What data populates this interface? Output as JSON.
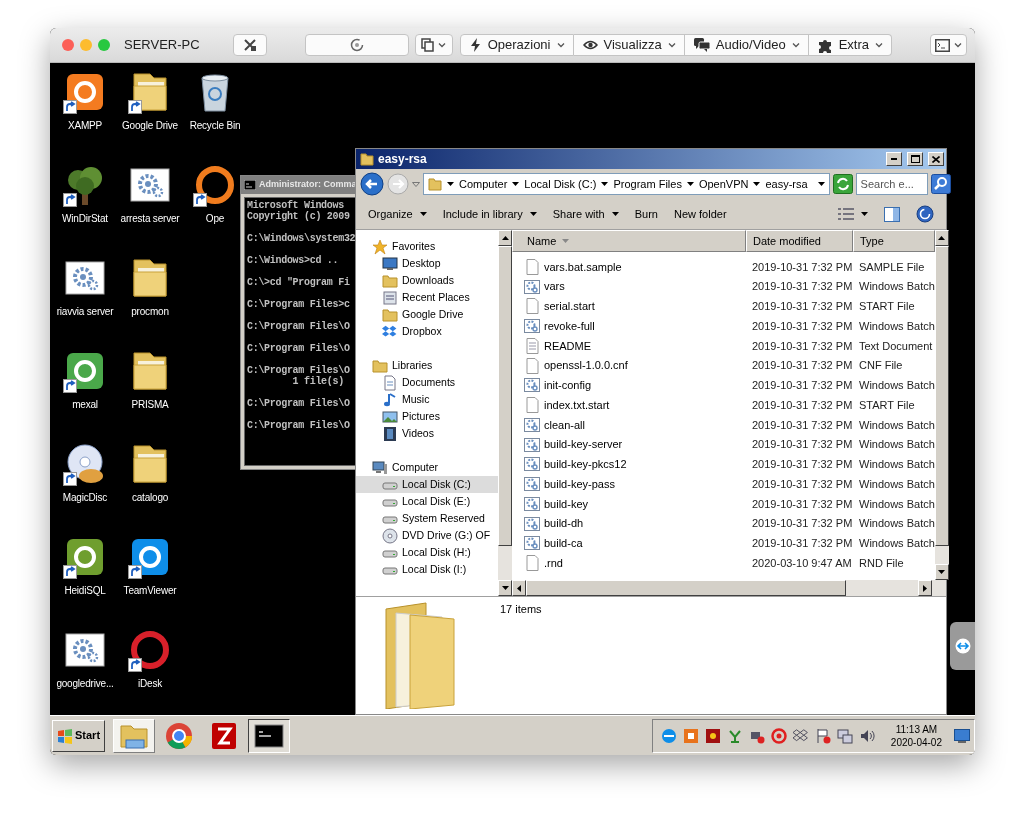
{
  "remote_window": {
    "title": "SERVER-PC",
    "menus": [
      {
        "kind": "bolt",
        "label": "Operazioni"
      },
      {
        "kind": "eye",
        "label": "Visualizza"
      },
      {
        "kind": "chat",
        "label": "Audio/Video"
      },
      {
        "kind": "puzzle",
        "label": "Extra"
      }
    ]
  },
  "desktop": {
    "icon_columns": [
      [
        {
          "label": "XAMPP",
          "kind": "app",
          "color": "#f47b20",
          "shortcut": true
        },
        {
          "label": "WinDirStat",
          "kind": "tree",
          "shortcut": true
        },
        {
          "label": "riavvia server",
          "kind": "script",
          "shortcut": false
        },
        {
          "label": "mexal",
          "kind": "app",
          "color": "#4aa84a",
          "shortcut": true
        },
        {
          "label": "MagicDisc",
          "kind": "disc",
          "shortcut": true
        },
        {
          "label": "HeidiSQL",
          "kind": "app",
          "color": "#6f9e2e",
          "shortcut": true
        },
        {
          "label": "googledrive...",
          "kind": "script",
          "shortcut": false
        }
      ],
      [
        {
          "label": "Google Drive",
          "kind": "folder",
          "shortcut": true
        },
        {
          "label": "arresta server",
          "kind": "script",
          "shortcut": false
        },
        {
          "label": "procmon",
          "kind": "folder",
          "shortcut": false
        },
        {
          "label": "PRISMA",
          "kind": "folder",
          "shortcut": false
        },
        {
          "label": "catalogo",
          "kind": "folder",
          "shortcut": false
        },
        {
          "label": "TeamViewer",
          "kind": "app",
          "color": "#0e8ee9",
          "shortcut": true
        },
        {
          "label": "iDesk",
          "kind": "ring",
          "color": "#d8202a",
          "shortcut": true
        }
      ],
      [
        {
          "label": "Recycle Bin",
          "kind": "bin",
          "shortcut": false
        },
        {
          "label": "Ope",
          "kind": "ring",
          "color": "#f07c1e",
          "shortcut": true
        }
      ]
    ]
  },
  "console": {
    "title": "Administrator: Comma",
    "paragraphs": [
      [
        "Microsoft Windows",
        "Copyright (c) 2009"
      ],
      [
        "C:\\Windows\\system32"
      ],
      [
        "C:\\Windows>cd .."
      ],
      [
        "C:\\>cd \"Program Fi"
      ],
      [
        "C:\\Program Files>c"
      ],
      [
        "C:\\Program Files\\O"
      ],
      [
        "C:\\Program Files\\O"
      ],
      [
        "C:\\Program Files\\O",
        "        1 file(s)"
      ],
      [
        "C:\\Program Files\\O"
      ],
      [
        "C:\\Program Files\\O"
      ]
    ]
  },
  "explorer": {
    "title": "easy-rsa",
    "breadcrumbs": [
      "Computer",
      "Local Disk (C:)",
      "Program Files",
      "OpenVPN",
      "easy-rsa"
    ],
    "search_placeholder": "Search e...",
    "commands": [
      {
        "label": "Organize",
        "dropdown": true
      },
      {
        "label": "Include in library",
        "dropdown": true
      },
      {
        "label": "Share with",
        "dropdown": true
      },
      {
        "label": "Burn",
        "dropdown": false
      },
      {
        "label": "New folder",
        "dropdown": false
      }
    ],
    "nav": [
      {
        "label": "Favorites",
        "kind": "star",
        "selected": false,
        "children": [
          {
            "label": "Desktop",
            "kind": "monitor",
            "selected": false
          },
          {
            "label": "Downloads",
            "kind": "folder",
            "selected": false
          },
          {
            "label": "Recent Places",
            "kind": "recent",
            "selected": false
          },
          {
            "label": "Google Drive",
            "kind": "folder",
            "selected": false
          },
          {
            "label": "Dropbox",
            "kind": "dropbox",
            "selected": false
          }
        ]
      },
      {
        "label": "Libraries",
        "kind": "folder",
        "selected": false,
        "children": [
          {
            "label": "Documents",
            "kind": "document",
            "selected": false
          },
          {
            "label": "Music",
            "kind": "music",
            "selected": false
          },
          {
            "label": "Pictures",
            "kind": "picture",
            "selected": false
          },
          {
            "label": "Videos",
            "kind": "film",
            "selected": false
          }
        ]
      },
      {
        "label": "Computer",
        "kind": "computer",
        "selected": false,
        "children": [
          {
            "label": "Local Disk (C:)",
            "kind": "drive",
            "selected": true
          },
          {
            "label": "Local Disk (E:)",
            "kind": "drive",
            "selected": false
          },
          {
            "label": "System Reserved",
            "kind": "drive",
            "selected": false
          },
          {
            "label": "DVD Drive (G:) OF",
            "kind": "disc",
            "selected": false
          },
          {
            "label": "Local Disk (H:)",
            "kind": "drive",
            "selected": false
          },
          {
            "label": "Local Disk (I:)",
            "kind": "drive",
            "selected": false
          }
        ]
      }
    ],
    "columns": [
      "Name",
      "Date modified",
      "Type"
    ],
    "rows": [
      {
        "name": "vars.bat.sample",
        "date": "2019-10-31 7:32 PM",
        "type": "SAMPLE File",
        "kind": "file"
      },
      {
        "name": "vars",
        "date": "2019-10-31 7:32 PM",
        "type": "Windows Batch",
        "kind": "batch"
      },
      {
        "name": "serial.start",
        "date": "2019-10-31 7:32 PM",
        "type": "START File",
        "kind": "file"
      },
      {
        "name": "revoke-full",
        "date": "2019-10-31 7:32 PM",
        "type": "Windows Batch",
        "kind": "batch"
      },
      {
        "name": "README",
        "date": "2019-10-31 7:32 PM",
        "type": "Text Document",
        "kind": "text"
      },
      {
        "name": "openssl-1.0.0.cnf",
        "date": "2019-10-31 7:32 PM",
        "type": "CNF File",
        "kind": "file"
      },
      {
        "name": "init-config",
        "date": "2019-10-31 7:32 PM",
        "type": "Windows Batch",
        "kind": "batch"
      },
      {
        "name": "index.txt.start",
        "date": "2019-10-31 7:32 PM",
        "type": "START File",
        "kind": "file"
      },
      {
        "name": "clean-all",
        "date": "2019-10-31 7:32 PM",
        "type": "Windows Batch",
        "kind": "batch"
      },
      {
        "name": "build-key-server",
        "date": "2019-10-31 7:32 PM",
        "type": "Windows Batch",
        "kind": "batch"
      },
      {
        "name": "build-key-pkcs12",
        "date": "2019-10-31 7:32 PM",
        "type": "Windows Batch",
        "kind": "batch"
      },
      {
        "name": "build-key-pass",
        "date": "2019-10-31 7:32 PM",
        "type": "Windows Batch",
        "kind": "batch"
      },
      {
        "name": "build-key",
        "date": "2019-10-31 7:32 PM",
        "type": "Windows Batch",
        "kind": "batch"
      },
      {
        "name": "build-dh",
        "date": "2019-10-31 7:32 PM",
        "type": "Windows Batch",
        "kind": "batch"
      },
      {
        "name": "build-ca",
        "date": "2019-10-31 7:32 PM",
        "type": "Windows Batch",
        "kind": "batch"
      },
      {
        "name": ".rnd",
        "date": "2020-03-10 9:47 AM",
        "type": "RND File",
        "kind": "file"
      }
    ],
    "status": "17 items"
  },
  "taskbar": {
    "start_label": "Start",
    "apps": [
      {
        "kind": "explorer",
        "active": true,
        "running": false
      },
      {
        "kind": "chrome",
        "active": false,
        "running": false
      },
      {
        "kind": "filezilla",
        "active": false,
        "running": false
      },
      {
        "kind": "console",
        "active": false,
        "running": true
      }
    ],
    "clock": {
      "time": "11:13 AM",
      "date": "2020-04-02"
    }
  }
}
